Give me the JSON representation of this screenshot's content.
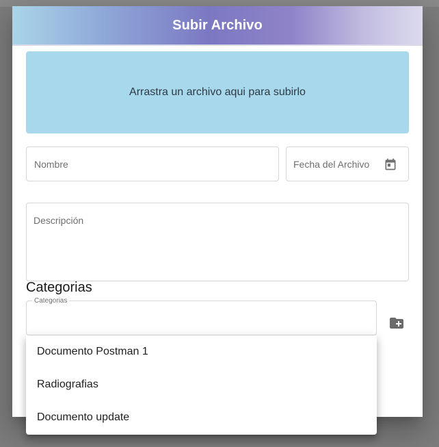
{
  "dialog": {
    "title": "Subir Archivo"
  },
  "dropzone": {
    "text": "Arrastra un archivo aqui para subirlo"
  },
  "form": {
    "nombre_label": "Nombre",
    "fecha_label": "Fecha del Archivo",
    "descripcion_label": "Descripción"
  },
  "categorias": {
    "section_title": "Categorias",
    "field_label": "Categorias",
    "options": [
      "Documento Postman 1",
      "Radiografias",
      "Documento update"
    ]
  },
  "icons": {
    "calendar": "calendar-icon",
    "add_folder": "create-new-folder-icon"
  },
  "colors": {
    "dropzone": "#a8d8ec",
    "header_gradient_start": "#a9d5e9",
    "header_gradient_mid": "#7b78c2",
    "header_gradient_end": "#dcdaee"
  }
}
